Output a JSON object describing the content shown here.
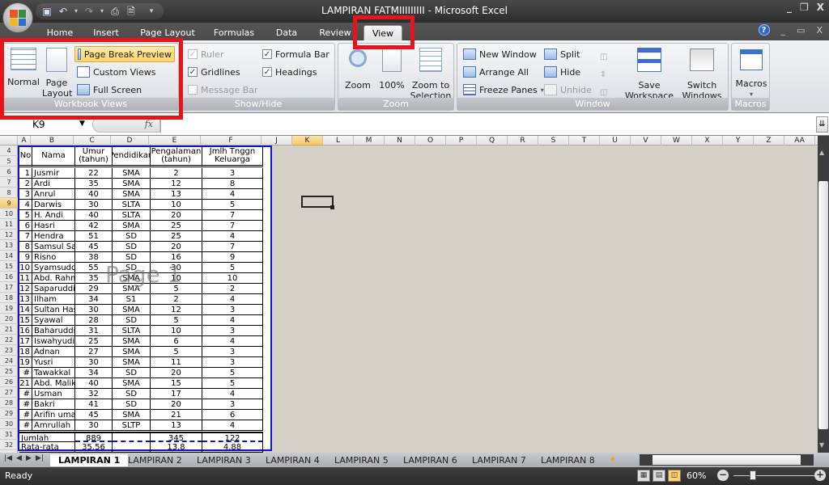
{
  "window": {
    "title": "LAMPIRAN FATMIIIIIIIII - Microsoft Excel",
    "quick_access": [
      "save-icon",
      "undo-icon",
      "redo-icon",
      "print-icon",
      "print-preview-icon",
      "customize-icon"
    ]
  },
  "tabs": [
    {
      "label": "Home"
    },
    {
      "label": "Insert"
    },
    {
      "label": "Page Layout"
    },
    {
      "label": "Formulas"
    },
    {
      "label": "Data"
    },
    {
      "label": "Review"
    },
    {
      "label": "View",
      "active": true
    }
  ],
  "ribbon": {
    "workbook_views": {
      "label": "Workbook Views",
      "normal": "Normal",
      "page_layout_1": "Page",
      "page_layout_2": "Layout",
      "page_break_preview": "Page Break Preview",
      "custom_views": "Custom Views",
      "full_screen": "Full Screen"
    },
    "show_hide": {
      "label": "Show/Hide",
      "ruler": {
        "label": "Ruler",
        "checked": true,
        "disabled": true
      },
      "gridlines": {
        "label": "Gridlines",
        "checked": true
      },
      "message_bar": {
        "label": "Message Bar",
        "checked": false,
        "disabled": true
      },
      "formula_bar": {
        "label": "Formula Bar",
        "checked": true
      },
      "headings": {
        "label": "Headings",
        "checked": true
      }
    },
    "zoom": {
      "label": "Zoom",
      "zoom": "Zoom",
      "hundred": "100%",
      "zoom_sel_1": "Zoom to",
      "zoom_sel_2": "Selection"
    },
    "window": {
      "label": "Window",
      "new_window": "New Window",
      "arrange_all": "Arrange All",
      "freeze_panes": "Freeze Panes",
      "split": "Split",
      "hide": "Hide",
      "unhide": "Unhide",
      "save_ws_1": "Save",
      "save_ws_2": "Workspace",
      "switch_1": "Switch",
      "switch_2": "Windows"
    },
    "macros": {
      "label": "Macros",
      "macros": "Macros"
    }
  },
  "formula_bar": {
    "name_box": "K9",
    "fx": "fx",
    "value": ""
  },
  "columns": [
    "A",
    "B",
    "C",
    "D",
    "E",
    "F",
    "J",
    "K",
    "L",
    "M",
    "N",
    "O",
    "P",
    "Q",
    "R",
    "S",
    "T",
    "U",
    "V",
    "W",
    "X",
    "Y",
    "Z",
    "AA"
  ],
  "selected_column": "K",
  "row_numbers": [
    "4",
    "5",
    "6",
    "7",
    "8",
    "9",
    "10",
    "11",
    "12",
    "13",
    "14",
    "15",
    "16",
    "17",
    "18",
    "19",
    "20",
    "21",
    "22",
    "23",
    "24",
    "25",
    "26",
    "27",
    "28",
    "29",
    "30",
    "31",
    "32"
  ],
  "selected_row": "9",
  "table": {
    "headers": {
      "no": "No",
      "nama": "Nama",
      "umur_1": "Umur",
      "umur_2": "(tahun)",
      "pendidikan": "Pendidikan",
      "peng_1": "Pengalaman",
      "peng_2": "(tahun)",
      "jml_1": "Jmlh Tnggn",
      "jml_2": "Keluarga"
    },
    "rows": [
      [
        "1",
        "Jusmir",
        "22",
        "SMA",
        "2",
        "3"
      ],
      [
        "2",
        "Ardi",
        "35",
        "SMA",
        "12",
        "8"
      ],
      [
        "3",
        "Anrul",
        "40",
        "SMA",
        "13",
        "4"
      ],
      [
        "4",
        "Darwis",
        "30",
        "SLTA",
        "10",
        "5"
      ],
      [
        "5",
        "H. Andi",
        "40",
        "SLTA",
        "20",
        "7"
      ],
      [
        "6",
        "Hasri",
        "42",
        "SMA",
        "25",
        "7"
      ],
      [
        "7",
        "Hendra",
        "51",
        "SD",
        "25",
        "4"
      ],
      [
        "8",
        "Samsul Sa",
        "45",
        "SD",
        "20",
        "7"
      ],
      [
        "9",
        "Risno",
        "38",
        "SD",
        "16",
        "9"
      ],
      [
        "10",
        "Syamsudd",
        "55",
        "SD",
        "30",
        "5"
      ],
      [
        "11",
        "Abd. Rahm",
        "35",
        "SMA",
        "10",
        "10"
      ],
      [
        "12",
        "Saparuddi",
        "29",
        "SMA",
        "5",
        "2"
      ],
      [
        "13",
        "Ilham",
        "34",
        "S1",
        "2",
        "4"
      ],
      [
        "14",
        "Sultan Has",
        "30",
        "SMA",
        "12",
        "3"
      ],
      [
        "15",
        "Syawal",
        "28",
        "SD",
        "5",
        "4"
      ],
      [
        "16",
        "Baharuddi",
        "31",
        "SLTA",
        "10",
        "3"
      ],
      [
        "17",
        "Iswahyudi",
        "25",
        "SMA",
        "6",
        "4"
      ],
      [
        "18",
        "Adnan",
        "27",
        "SMA",
        "5",
        "3"
      ],
      [
        "19",
        "Yusri",
        "30",
        "SMA",
        "11",
        "3"
      ],
      [
        "#",
        "Tawakkal",
        "34",
        "SD",
        "20",
        "5"
      ],
      [
        "21",
        "Abd. Malik",
        "40",
        "SMA",
        "15",
        "5"
      ],
      [
        "#",
        "Usman",
        "32",
        "SD",
        "17",
        "4"
      ],
      [
        "#",
        "Bakri",
        "41",
        "SD",
        "20",
        "3"
      ],
      [
        "#",
        "Arifin umar",
        "45",
        "SMA",
        "21",
        "6"
      ],
      [
        "#",
        "Amrullah",
        "30",
        "SLTP",
        "13",
        "4"
      ]
    ],
    "jumlah": {
      "label": "Jumlah",
      "umur": "889",
      "pengalaman": "345",
      "jml": "122"
    },
    "rata": {
      "label": "Rata-rata",
      "umur": "35.56",
      "pengalaman": "13.8",
      "jml": "4.88"
    }
  },
  "page_watermark": "Page 1",
  "sheet_tabs": [
    "LAMPIRAN 1",
    "LAMPIRAN 2",
    "LAMPIRAN 3",
    "LAMPIRAN 4",
    "LAMPIRAN 5",
    "LAMPIRAN 6",
    "LAMPIRAN 7",
    "LAMPIRAN 8"
  ],
  "active_sheet": "LAMPIRAN 1",
  "status": {
    "ready": "Ready",
    "zoom": "60%",
    "zoom_percent": 60
  }
}
